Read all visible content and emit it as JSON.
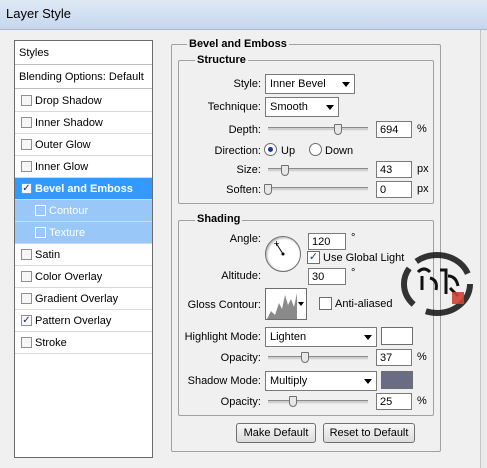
{
  "window": {
    "title": "Layer Style"
  },
  "styles_panel": {
    "header": "Styles",
    "blending": "Blending Options: Default",
    "items": [
      {
        "label": "Drop Shadow",
        "checked": false
      },
      {
        "label": "Inner Shadow",
        "checked": false
      },
      {
        "label": "Outer Glow",
        "checked": false
      },
      {
        "label": "Inner Glow",
        "checked": false
      },
      {
        "label": "Bevel and Emboss",
        "checked": true,
        "selected": true
      },
      {
        "label": "Contour",
        "checked": false,
        "sub": true
      },
      {
        "label": "Texture",
        "checked": false,
        "sub": true
      },
      {
        "label": "Satin",
        "checked": false
      },
      {
        "label": "Color Overlay",
        "checked": false
      },
      {
        "label": "Gradient Overlay",
        "checked": false
      },
      {
        "label": "Pattern Overlay",
        "checked": true
      },
      {
        "label": "Stroke",
        "checked": false
      }
    ],
    "check_mark": "✓"
  },
  "bevel": {
    "group_title": "Bevel and Emboss",
    "structure": {
      "title": "Structure",
      "style_label": "Style:",
      "style_value": "Inner Bevel",
      "technique_label": "Technique:",
      "technique_value": "Smooth",
      "depth_label": "Depth:",
      "depth_value": "694",
      "depth_unit": "%",
      "depth_level": 0.7,
      "direction_label": "Direction:",
      "direction_up": "Up",
      "direction_down": "Down",
      "direction_selected": "Up",
      "size_label": "Size:",
      "size_value": "43",
      "size_unit": "px",
      "size_level": 0.17,
      "soften_label": "Soften:",
      "soften_value": "0",
      "soften_unit": "px",
      "soften_level": 0.0
    },
    "shading": {
      "title": "Shading",
      "angle_label": "Angle:",
      "angle_value": "120",
      "angle_unit": "°",
      "global_light_label": "Use Global Light",
      "global_light_checked": true,
      "altitude_label": "Altitude:",
      "altitude_value": "30",
      "altitude_unit": "°",
      "gloss_label": "Gloss Contour:",
      "anti_aliased_label": "Anti-aliased",
      "anti_aliased_checked": false,
      "highlight_mode_label": "Highlight Mode:",
      "highlight_mode_value": "Lighten",
      "highlight_color": "#ffffff",
      "highlight_opacity_label": "Opacity:",
      "highlight_opacity_value": "37",
      "highlight_opacity_unit": "%",
      "highlight_opacity_level": 0.37,
      "shadow_mode_label": "Shadow Mode:",
      "shadow_mode_value": "Multiply",
      "shadow_color": "#6b6b84",
      "shadow_opacity_label": "Opacity:",
      "shadow_opacity_value": "25",
      "shadow_opacity_unit": "%",
      "shadow_opacity_level": 0.25
    },
    "make_default_label": "Make Default",
    "reset_default_label": "Reset to Default"
  },
  "colors": {
    "selected": "#3399ff",
    "sub": "#99c7f7"
  }
}
